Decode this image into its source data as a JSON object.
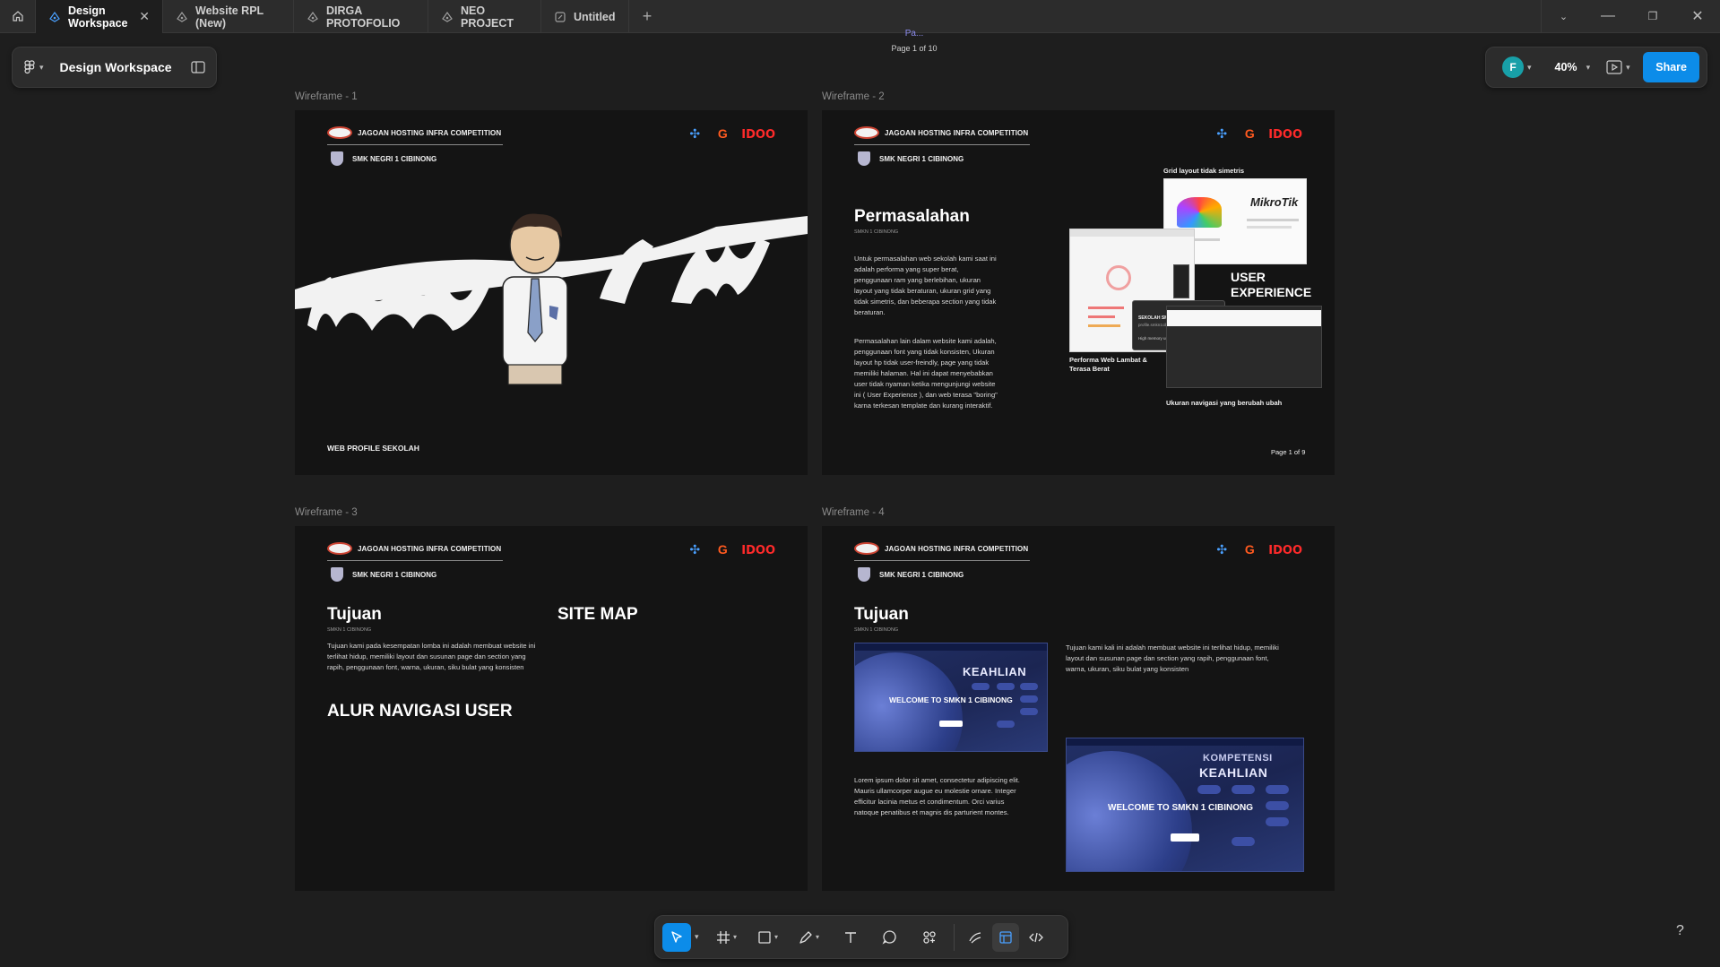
{
  "tabs": [
    {
      "label": "Design Workspace",
      "active": true
    },
    {
      "label": "Website RPL (New)"
    },
    {
      "label": "DIRGA PROTOFOLIO"
    },
    {
      "label": "NEO PROJECT"
    },
    {
      "label": "Untitled"
    }
  ],
  "left_panel": {
    "title": "Design Workspace"
  },
  "right_panel": {
    "avatar_initial": "F",
    "zoom": "40%",
    "share_label": "Share"
  },
  "page_indicator": {
    "top": "Pa...",
    "text": "Page 1 of 10"
  },
  "common": {
    "competition": "JAGOAN HOSTING INFRA COMPETITION",
    "school": "SMK NEGRI 1 CIBINONG",
    "sponsor3": "IDOO"
  },
  "frames": [
    {
      "label": "Wireframe - 1",
      "title_art": "NAMA TIM",
      "footer": "WEB PROFILE SEKOLAH"
    },
    {
      "label": "Wireframe - 2",
      "heading": "Permasalahan",
      "subheading": "SMKN 1 CIBINONG",
      "para1": "Untuk permasalahan web sekolah kami saat ini adalah performa yang super berat, penggunaan ram yang berlebihan, ukuran layout yang tidak beraturan, ukuran grid yang tidak simetris, dan beberapa section yang tidak beraturan.",
      "para2": "Permasalahan lain dalam website kami adalah, penggunaan font yang tidak konsisten, Ukuran layout hp tidak user-freindly, page yang tidak memiliki halaman. Hal ini dapat menyebabkan user tidak nyaman ketika mengunjungi website ini ( User Experience ), dan web terasa \"boring\" karna terkesan template dan kurang interaktif.",
      "note_grid": "Grid layout tidak simetris",
      "note_ux": "USER EXPERIENCE",
      "note_perf": "Performa Web Lambat & Terasa Berat",
      "note_nav": "Ukuran navigasi yang berubah ubah",
      "page": "Page 1 of 9",
      "popup_title": "SEKOLAH SMKN 1 CIBINONG",
      "popup_sub": "profile.smkn1cibinong.sch.id",
      "popup_mem": "High memory usage: 1.2 GB",
      "mikrotik": "MikroTik"
    },
    {
      "label": "Wireframe - 3",
      "heading": "Tujuan",
      "subheading": "SMKN 1 CIBINONG",
      "para": "Tujuan kami pada kesempatan lomba ini adalah membuat website ini terlihat hidup, memiliki layout dan susunan page dan section yang rapih, penggunaan font, warna, ukuran, siku bulat yang konsisten",
      "sitemap": "SITE MAP",
      "alur": "ALUR NAVIGASI USER"
    },
    {
      "label": "Wireframe - 4",
      "heading": "Tujuan",
      "subheading": "SMKN 1 CIBINONG",
      "para_right": "Tujuan kami kali ini adalah membuat website ini terlihat hidup, memiliki layout dan susunan page dan section yang rapih, penggunaan font, warna, ukuran, siku bulat yang konsisten",
      "lorem": "Lorem ipsum dolor sit amet, consectetur adipiscing elit. Mauris ullamcorper augue eu molestie ornare. Integer efficitur lacinia metus et condimentum. Orci varius natoque penatibus et magnis dis parturient montes.",
      "shot_keahlian": "KEAHLIAN",
      "shot_kompetensi": "KOMPETENSI",
      "shot_welcome": "WELCOME TO SMKN 1 CIBINONG"
    }
  ],
  "toolbar": {
    "tools": [
      "move",
      "frame",
      "rectangle",
      "pen",
      "text",
      "comment",
      "actions",
      "draw",
      "dev-mode",
      "code"
    ]
  },
  "help": "?",
  "colors": {
    "accent": "#0c8ce9",
    "canvas": "#1e1e1e",
    "frame_bg": "#141414"
  }
}
